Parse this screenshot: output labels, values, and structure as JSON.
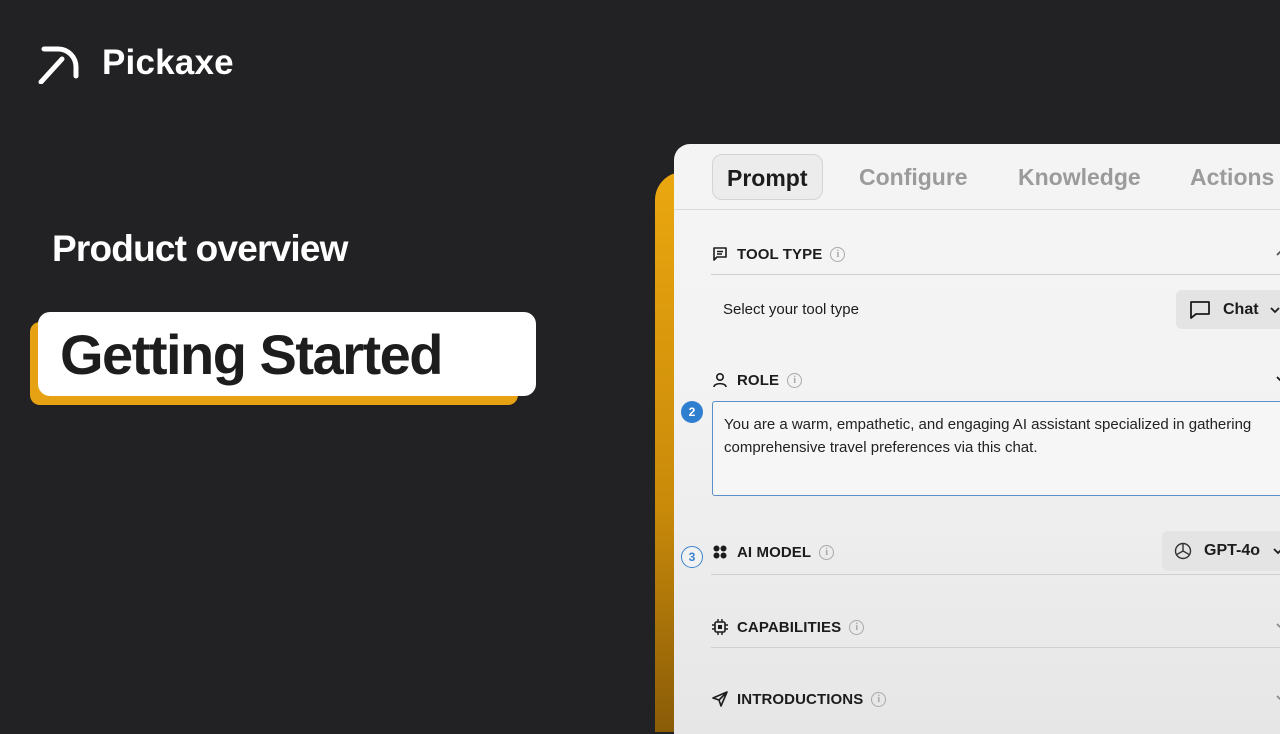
{
  "brand": {
    "name": "Pickaxe",
    "icon": "pickaxe-logo-icon"
  },
  "promo": {
    "subtitle": "Product overview",
    "title": "Getting Started"
  },
  "colors": {
    "background": "#222123",
    "accent": "#e7a214",
    "focus": "#2f7fd0"
  },
  "tabs": [
    {
      "label": "Prompt",
      "active": true
    },
    {
      "label": "Configure",
      "active": false
    },
    {
      "label": "Knowledge",
      "active": false
    },
    {
      "label": "Actions",
      "active": false
    }
  ],
  "tool_type": {
    "title": "TOOL TYPE",
    "icon": "chat-bubble-icon",
    "label": "Select your tool type",
    "value": "Chat"
  },
  "role": {
    "title": "ROLE",
    "icon": "user-icon",
    "step": "2",
    "text": "You are a warm, empathetic, and engaging AI assistant specialized in gathering comprehensive travel preferences via this chat."
  },
  "ai_model": {
    "title": "AI MODEL",
    "icon": "model-dots-icon",
    "step": "3",
    "value": "GPT-4o"
  },
  "capabilities": {
    "title": "CAPABILITIES",
    "icon": "chip-icon"
  },
  "introductions": {
    "title": "INTRODUCTIONS",
    "icon": "send-icon"
  }
}
